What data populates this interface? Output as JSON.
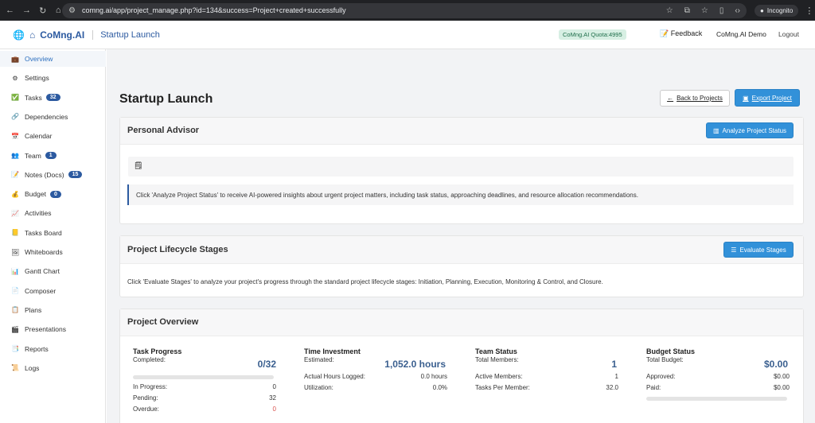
{
  "browser": {
    "url": "comng.ai/app/project_manage.php?id=134&success=Project+created+successfully",
    "incognito_label": "Incognito"
  },
  "header": {
    "brand": "CoMng.AI",
    "project_title": "Startup Launch",
    "quota": "CoMng.AI Quota:4995",
    "feedback": "Feedback",
    "user": "CoMng.AI Demo",
    "logout": "Logout"
  },
  "sidebar": {
    "items": [
      {
        "label": "Overview",
        "icon": "briefcase-icon",
        "glyph": "💼"
      },
      {
        "label": "Settings",
        "icon": "gear-icon",
        "glyph": "⚙"
      },
      {
        "label": "Tasks",
        "icon": "check-icon",
        "glyph": "✅",
        "badge": "32"
      },
      {
        "label": "Dependencies",
        "icon": "link-icon",
        "glyph": "🔗"
      },
      {
        "label": "Calendar",
        "icon": "calendar-icon",
        "glyph": "📅"
      },
      {
        "label": "Team",
        "icon": "team-icon",
        "glyph": "👥",
        "badge": "1"
      },
      {
        "label": "Notes (Docs)",
        "icon": "notes-icon",
        "glyph": "📝",
        "badge": "15"
      },
      {
        "label": "Budget",
        "icon": "money-bag-icon",
        "glyph": "💰",
        "badge": "0"
      },
      {
        "label": "Activities",
        "icon": "activity-icon",
        "glyph": "📈"
      },
      {
        "label": "Tasks Board",
        "icon": "board-icon",
        "glyph": "📒"
      },
      {
        "label": "Whiteboards",
        "icon": "whiteboard-icon",
        "glyph": "🖼"
      },
      {
        "label": "Gantt Chart",
        "icon": "gantt-icon",
        "glyph": "📊"
      },
      {
        "label": "Composer",
        "icon": "composer-icon",
        "glyph": "📄"
      },
      {
        "label": "Plans",
        "icon": "plans-icon",
        "glyph": "📋"
      },
      {
        "label": "Presentations",
        "icon": "presentation-icon",
        "glyph": "🎬"
      },
      {
        "label": "Reports",
        "icon": "report-icon",
        "glyph": "📑"
      },
      {
        "label": "Logs",
        "icon": "logs-icon",
        "glyph": "📜"
      }
    ]
  },
  "main": {
    "title": "Startup Launch",
    "back_label": "Back to Projects",
    "export_label": "Export Project",
    "advisor": {
      "title": "Personal Advisor",
      "button": "Analyze Project Status",
      "message": "Click 'Analyze Project Status' to receive AI-powered insights about urgent project matters, including task status, approaching deadlines, and resource allocation recommendations."
    },
    "stages": {
      "title": "Project Lifecycle Stages",
      "button": "Evaluate Stages",
      "message": "Click 'Evaluate Stages' to analyze your project's progress through the standard project lifecycle stages: Initiation, Planning, Execution, Monitoring & Control, and Closure."
    },
    "overview": {
      "title": "Project Overview",
      "task": {
        "heading": "Task Progress",
        "completed_label": "Completed:",
        "completed_value": "0/32",
        "progress_fraction": 0,
        "in_progress_label": "In Progress:",
        "in_progress": "0",
        "pending_label": "Pending:",
        "pending": "32",
        "overdue_label": "Overdue:",
        "overdue": "0"
      },
      "time": {
        "heading": "Time Investment",
        "estimated_label": "Estimated:",
        "estimated_value": "1,052.0 hours",
        "actual_label": "Actual Hours Logged:",
        "actual": "0.0 hours",
        "utilization_label": "Utilization:",
        "utilization": "0.0%"
      },
      "team": {
        "heading": "Team Status",
        "members_label": "Total Members:",
        "members_value": "1",
        "active_label": "Active Members:",
        "active": "1",
        "per_member_label": "Tasks Per Member:",
        "per_member": "32.0"
      },
      "budget": {
        "heading": "Budget Status",
        "total_label": "Total Budget:",
        "total_value": "$0.00",
        "approved_label": "Approved:",
        "approved": "$0.00",
        "paid_label": "Paid:",
        "paid": "$0.00",
        "spent_fraction": 0
      }
    }
  },
  "colors": {
    "accent": "#2c5aa0",
    "button_blue": "#3291d9",
    "overdue_red": "#d9534f"
  }
}
